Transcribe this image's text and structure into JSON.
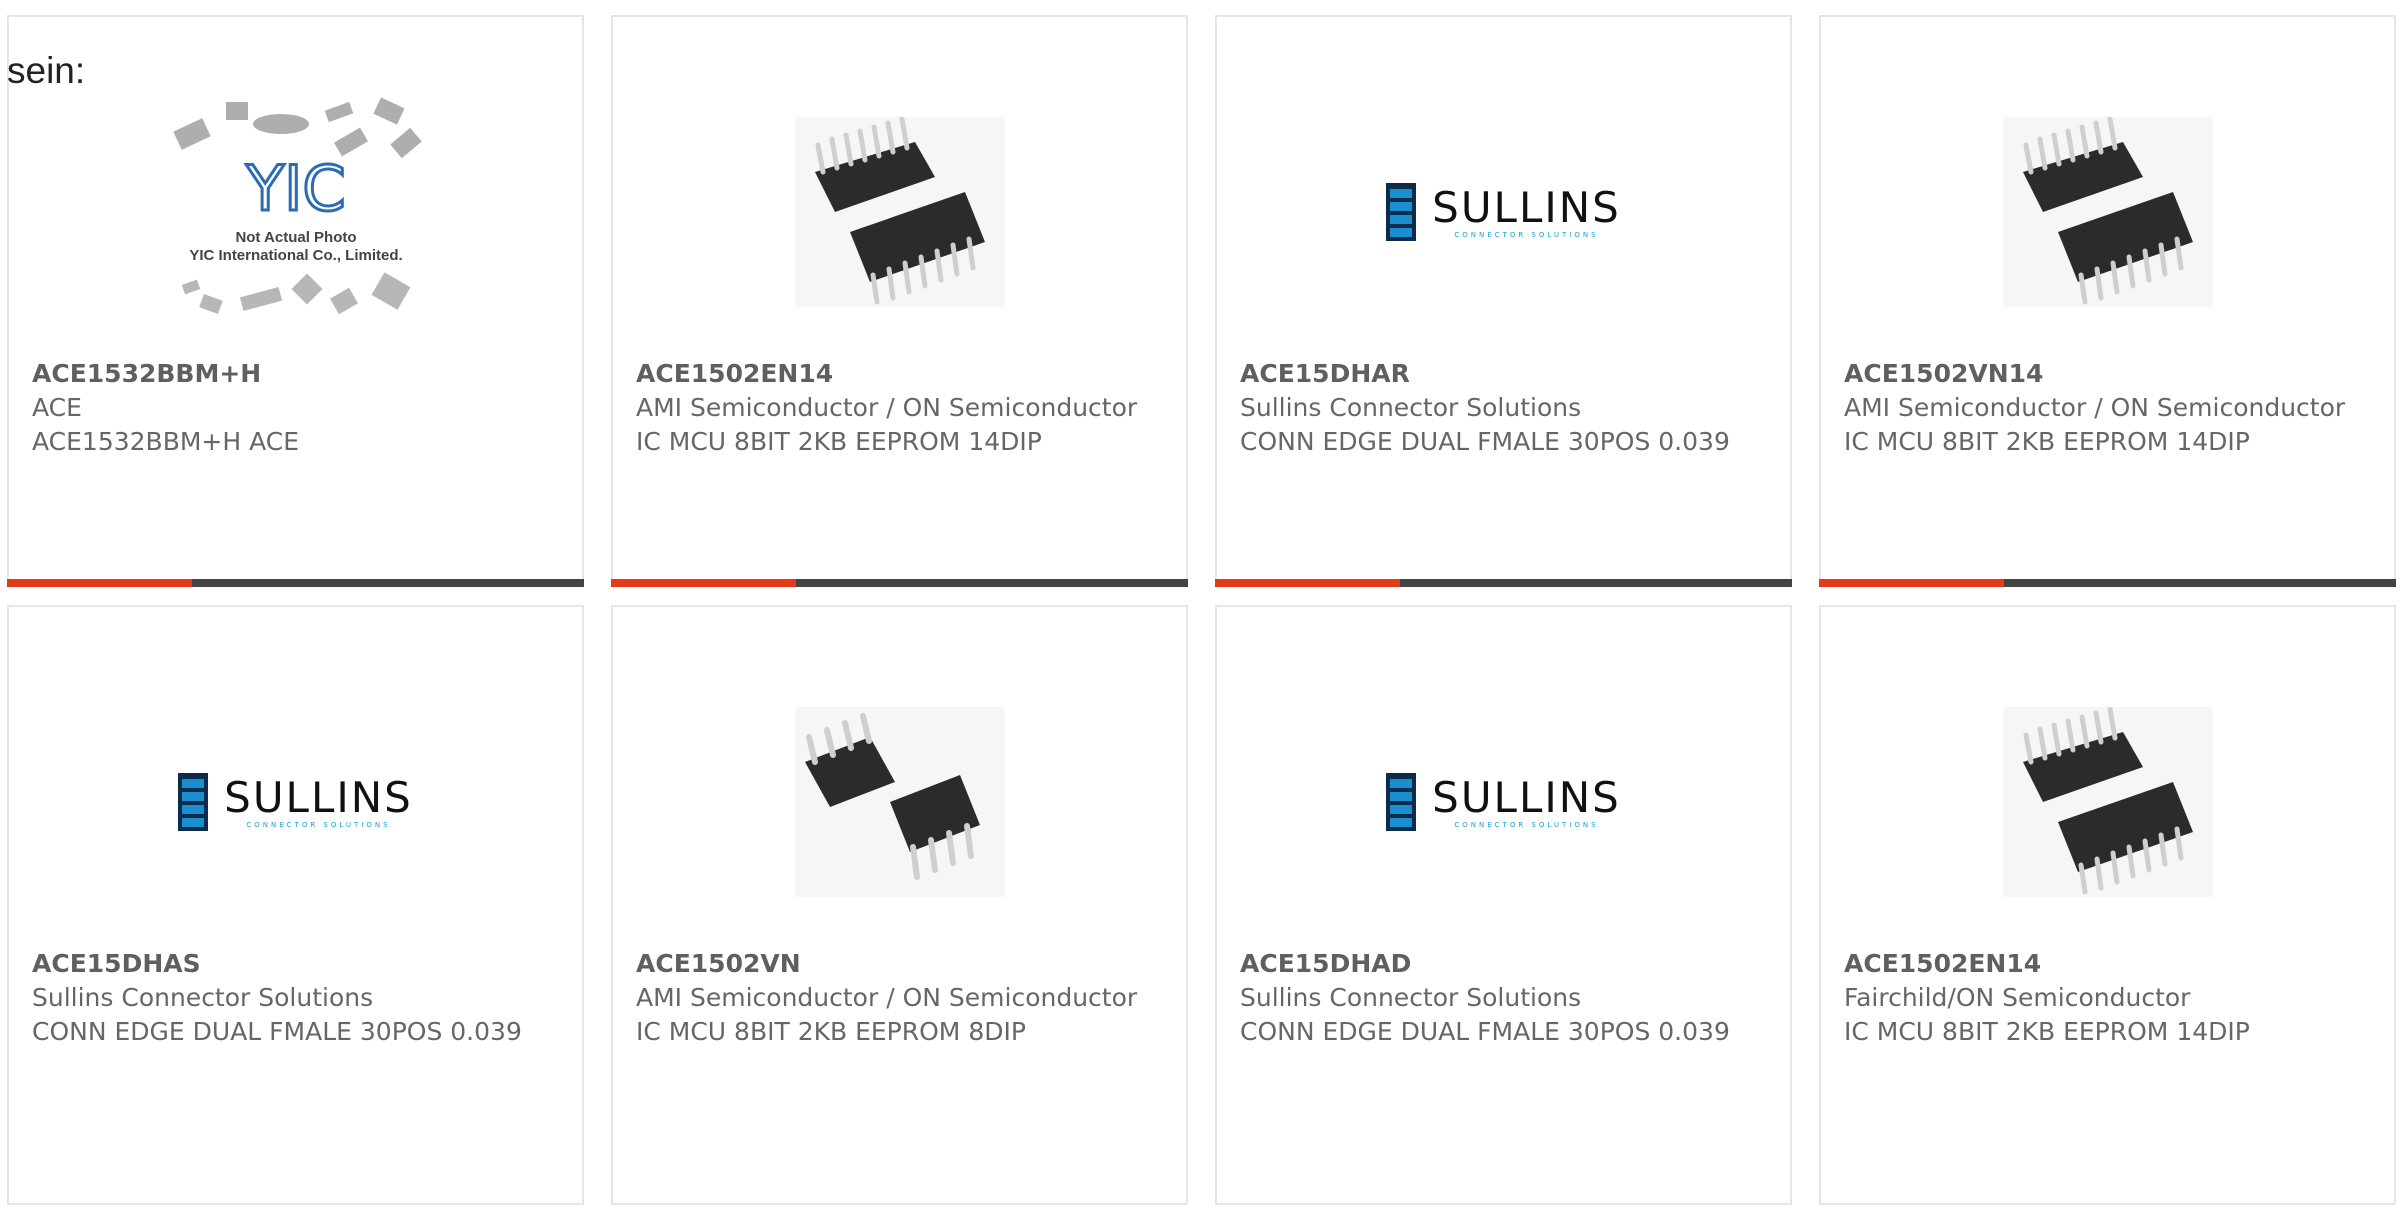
{
  "intro_text": "sein:",
  "colors": {
    "accent_red": "#e33b17",
    "accent_dark": "#444444",
    "card_border": "#e6e6e6",
    "text": "#666666"
  },
  "cards": [
    {
      "part_number": "ACE1532BBM+H",
      "manufacturer": "ACE",
      "description": "ACE1532BBM+H ACE",
      "image": "yic-placeholder",
      "image_text": {
        "logo": "YIC",
        "line1": "Not Actual Photo",
        "line2": "YIC International Co., Limited."
      }
    },
    {
      "part_number": "ACE1502EN14",
      "manufacturer": "AMI Semiconductor / ON Semiconductor",
      "description": "IC MCU 8BIT 2KB EEPROM 14DIP",
      "image": "dip14-chip"
    },
    {
      "part_number": "ACE15DHAR",
      "manufacturer": "Sullins Connector Solutions",
      "description": "CONN EDGE DUAL FMALE 30POS 0.039",
      "image": "sullins-logo",
      "logo_text": "SULLINS",
      "logo_subtext": "CONNECTOR SOLUTIONS"
    },
    {
      "part_number": "ACE1502VN14",
      "manufacturer": "AMI Semiconductor / ON Semiconductor",
      "description": "IC MCU 8BIT 2KB EEPROM 14DIP",
      "image": "dip14-chip"
    },
    {
      "part_number": "ACE15DHAS",
      "manufacturer": "Sullins Connector Solutions",
      "description": "CONN EDGE DUAL FMALE 30POS 0.039",
      "image": "sullins-logo",
      "logo_text": "SULLINS",
      "logo_subtext": "CONNECTOR SOLUTIONS"
    },
    {
      "part_number": "ACE1502VN",
      "manufacturer": "AMI Semiconductor / ON Semiconductor",
      "description": "IC MCU 8BIT 2KB EEPROM 8DIP",
      "image": "dip8-chip"
    },
    {
      "part_number": "ACE15DHAD",
      "manufacturer": "Sullins Connector Solutions",
      "description": "CONN EDGE DUAL FMALE 30POS 0.039",
      "image": "sullins-logo",
      "logo_text": "SULLINS",
      "logo_subtext": "CONNECTOR SOLUTIONS"
    },
    {
      "part_number": "ACE1502EN14",
      "manufacturer": "Fairchild/ON Semiconductor",
      "description": "IC MCU 8BIT 2KB EEPROM 14DIP",
      "image": "dip14-chip"
    }
  ]
}
